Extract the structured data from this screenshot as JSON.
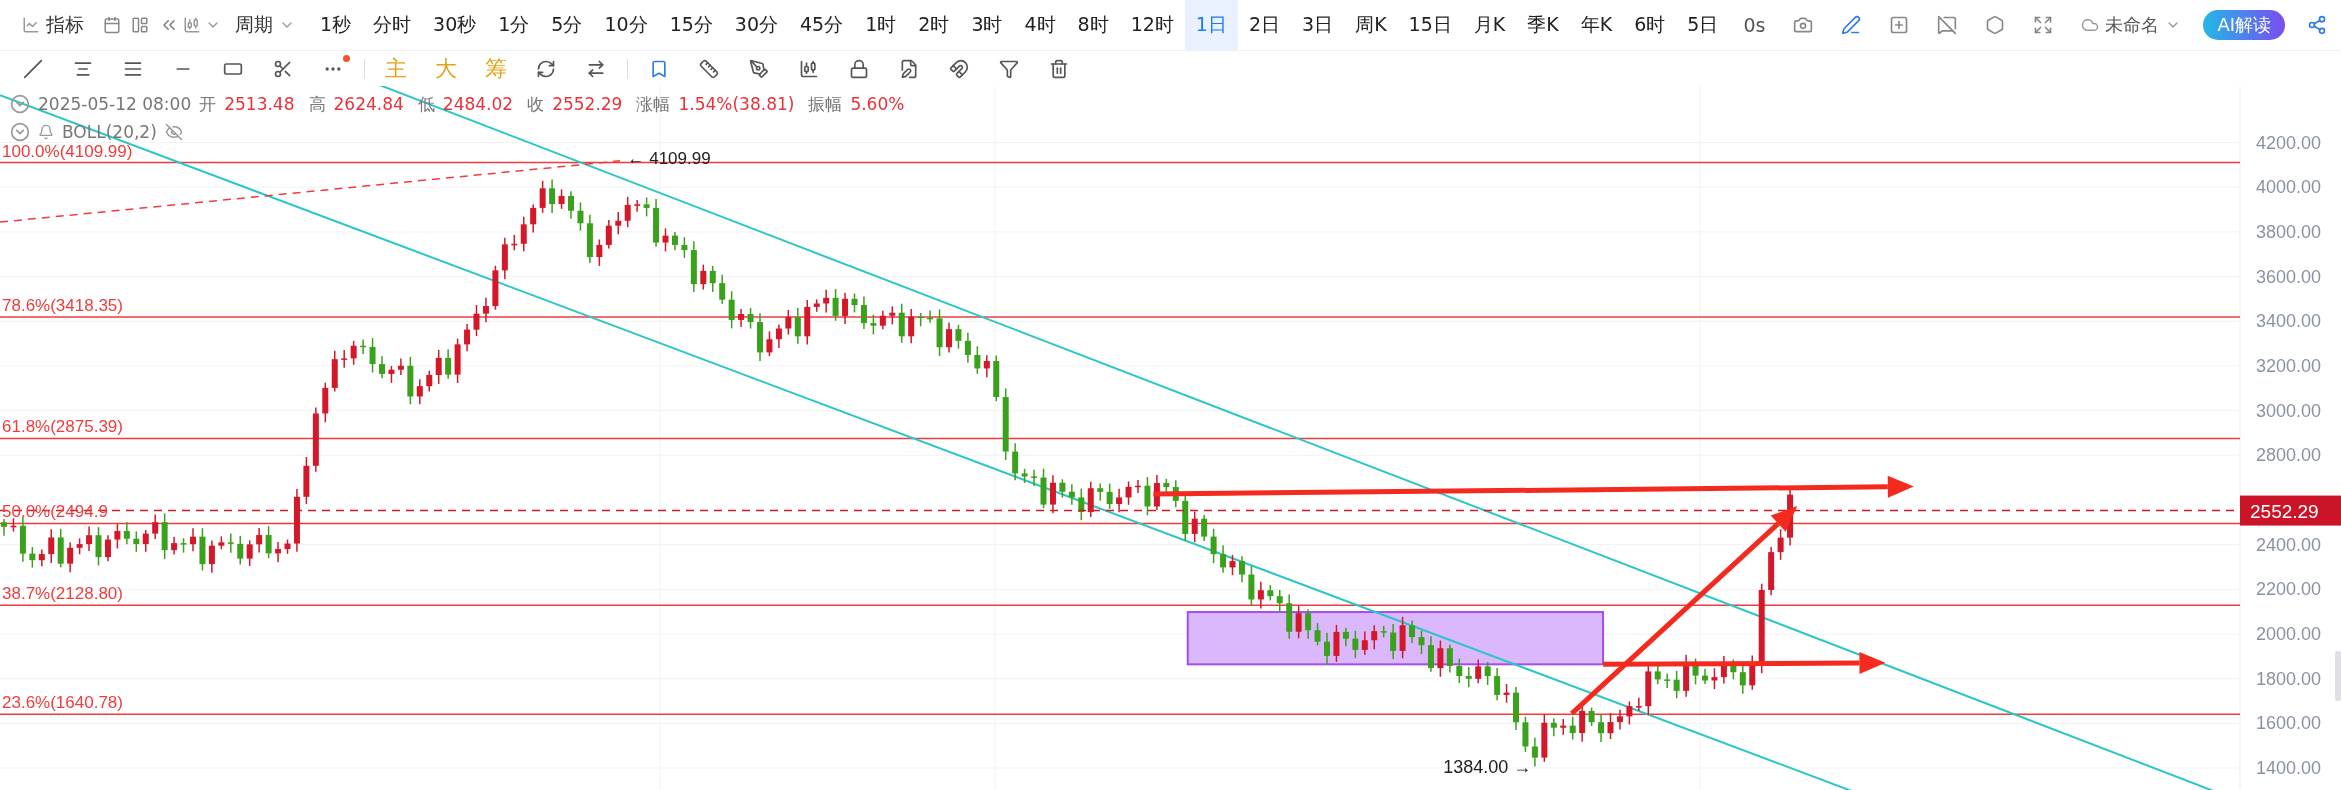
{
  "top_toolbar": {
    "indicator_button": "指标",
    "period_label": "周期",
    "periods": [
      {
        "label": "1秒",
        "selected": false
      },
      {
        "label": "分时",
        "selected": false
      },
      {
        "label": "30秒",
        "selected": false
      },
      {
        "label": "1分",
        "selected": false
      },
      {
        "label": "5分",
        "selected": false
      },
      {
        "label": "10分",
        "selected": false
      },
      {
        "label": "15分",
        "selected": false
      },
      {
        "label": "30分",
        "selected": false
      },
      {
        "label": "45分",
        "selected": false
      },
      {
        "label": "1时",
        "selected": false
      },
      {
        "label": "2时",
        "selected": false
      },
      {
        "label": "3时",
        "selected": false
      },
      {
        "label": "4时",
        "selected": false
      },
      {
        "label": "8时",
        "selected": false
      },
      {
        "label": "12时",
        "selected": false
      },
      {
        "label": "1日",
        "selected": true
      },
      {
        "label": "2日",
        "selected": false
      },
      {
        "label": "3日",
        "selected": false
      },
      {
        "label": "周K",
        "selected": false
      },
      {
        "label": "15日",
        "selected": false
      },
      {
        "label": "月K",
        "selected": false
      },
      {
        "label": "季K",
        "selected": false
      },
      {
        "label": "年K",
        "selected": false
      },
      {
        "label": "6时",
        "selected": false
      },
      {
        "label": "5日",
        "selected": false
      }
    ],
    "timer": "0s",
    "file_name": "未命名",
    "ai_button": "AI解读"
  },
  "drawing_toolbar": {
    "text_tools": [
      "主",
      "大",
      "筹"
    ]
  },
  "ohlc_bar": {
    "date": "2025-05-12 08:00",
    "fields": [
      {
        "label": "开",
        "value": "2513.48"
      },
      {
        "label": "高",
        "value": "2624.84"
      },
      {
        "label": "低",
        "value": "2484.02"
      },
      {
        "label": "收",
        "value": "2552.29"
      },
      {
        "label": "涨幅",
        "value": "1.54%(38.81)"
      },
      {
        "label": "振幅",
        "value": "5.60%"
      }
    ]
  },
  "indicator": {
    "name": "BOLL(20,2)"
  },
  "chart": {
    "fib_labels": [
      "100.0%(4109.99)",
      "78.6%(3418.35)",
      "61.8%(2875.39)",
      "50.0%(2494.9",
      "38.7%(2128.80)",
      "23.6%(1640.78)"
    ],
    "high_marker": "← 4109.99",
    "low_marker": "1384.00 →",
    "price_ticks": [
      "4200.00",
      "4000.00",
      "3800.00",
      "3600.00",
      "3400.00",
      "3200.00",
      "3000.00",
      "2800.00",
      "2400.00",
      "2200.00",
      "2000.00",
      "1800.00",
      "1600.00",
      "1400.00"
    ],
    "last_price": "2552.29"
  }
}
